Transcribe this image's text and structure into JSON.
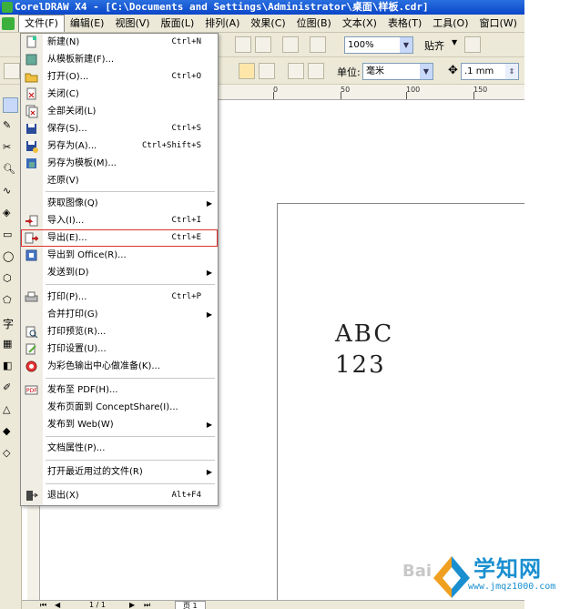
{
  "window": {
    "title": "CorelDRAW X4 - [C:\\Documents and Settings\\Administrator\\桌面\\样板.cdr]"
  },
  "menubar": {
    "items": [
      {
        "label": "文件(F)"
      },
      {
        "label": "编辑(E)"
      },
      {
        "label": "视图(V)"
      },
      {
        "label": "版面(L)"
      },
      {
        "label": "排列(A)"
      },
      {
        "label": "效果(C)"
      },
      {
        "label": "位图(B)"
      },
      {
        "label": "文本(X)"
      },
      {
        "label": "表格(T)"
      },
      {
        "label": "工具(O)"
      },
      {
        "label": "窗口(W)"
      }
    ]
  },
  "toolbar": {
    "zoom_value": "100%",
    "snap_label": "贴齐",
    "units_label": "单位:",
    "units_value": "毫米",
    "nudge_value": ".1 mm"
  },
  "ruler": {
    "top_numbers": [
      "0",
      "50",
      "100",
      "150"
    ]
  },
  "file_menu": {
    "items": [
      {
        "label": "新建(N)",
        "shortcut": "Ctrl+N",
        "icon": "new-document-icon"
      },
      {
        "label": "从模板新建(F)...",
        "shortcut": "",
        "icon": "template-icon"
      },
      {
        "label": "打开(O)...",
        "shortcut": "Ctrl+O",
        "icon": "open-folder-icon"
      },
      {
        "label": "关闭(C)",
        "shortcut": "",
        "icon": "close-document-icon"
      },
      {
        "label": "全部关闭(L)",
        "shortcut": "",
        "icon": "close-all-icon"
      },
      {
        "label": "保存(S)...",
        "shortcut": "Ctrl+S",
        "icon": "save-icon"
      },
      {
        "label": "另存为(A)...",
        "shortcut": "Ctrl+Shift+S",
        "icon": "save-as-icon"
      },
      {
        "label": "另存为模板(M)...",
        "shortcut": "",
        "icon": "save-template-icon"
      },
      {
        "label": "还原(V)",
        "shortcut": "",
        "icon": ""
      },
      {
        "label": "获取图像(Q)",
        "shortcut": "",
        "icon": "",
        "submenu": true
      },
      {
        "label": "导入(I)...",
        "shortcut": "Ctrl+I",
        "icon": "import-icon"
      },
      {
        "label": "导出(E)...",
        "shortcut": "Ctrl+E",
        "icon": "export-icon",
        "highlighted": true
      },
      {
        "label": "导出到 Office(R)...",
        "shortcut": "",
        "icon": "export-office-icon"
      },
      {
        "label": "发送到(D)",
        "shortcut": "",
        "icon": "",
        "submenu": true
      },
      {
        "label": "打印(P)...",
        "shortcut": "Ctrl+P",
        "icon": "print-icon"
      },
      {
        "label": "合并打印(G)",
        "shortcut": "",
        "icon": "",
        "submenu": true
      },
      {
        "label": "打印预览(R)...",
        "shortcut": "",
        "icon": "print-preview-icon"
      },
      {
        "label": "打印设置(U)...",
        "shortcut": "",
        "icon": "print-setup-icon"
      },
      {
        "label": "为彩色输出中心做准备(K)...",
        "shortcut": "",
        "icon": "color-output-icon"
      },
      {
        "label": "发布至 PDF(H)...",
        "shortcut": "",
        "icon": "pdf-icon"
      },
      {
        "label": "发布页面到 ConceptShare(I)...",
        "shortcut": "",
        "icon": ""
      },
      {
        "label": "发布到 Web(W)",
        "shortcut": "",
        "icon": "",
        "submenu": true
      },
      {
        "label": "文档属性(P)...",
        "shortcut": "",
        "icon": ""
      },
      {
        "label": "打开最近用过的文件(R)",
        "shortcut": "",
        "icon": "",
        "submenu": true
      },
      {
        "label": "退出(X)",
        "shortcut": "Alt+F4",
        "icon": "exit-icon"
      }
    ]
  },
  "document": {
    "line1": "ABC",
    "line2": "123"
  },
  "pagebar": {
    "page_count": "1 / 1",
    "page_tab": "页 1"
  },
  "watermark": {
    "brand": "学知网",
    "url": "www.jmqz1000.com",
    "baidu": "Bai"
  }
}
